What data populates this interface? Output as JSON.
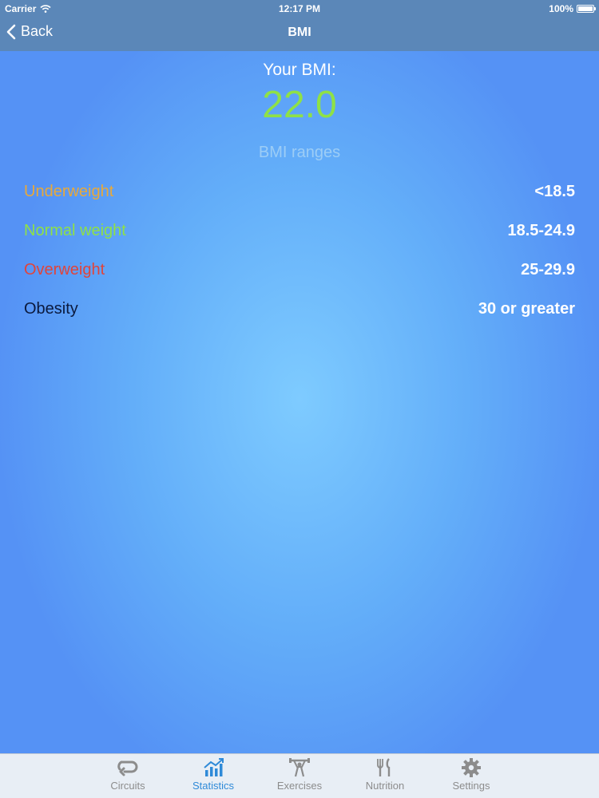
{
  "status_bar": {
    "carrier": "Carrier",
    "time": "12:17 PM",
    "battery": "100%",
    "battery_level": 1.0
  },
  "nav": {
    "back_label": "Back",
    "title": "BMI"
  },
  "bmi": {
    "label": "Your BMI:",
    "value": "22.0"
  },
  "ranges": {
    "heading": "BMI ranges",
    "items": [
      {
        "name": "Underweight",
        "value": "<18.5",
        "color": "#e8a93a"
      },
      {
        "name": "Normal weight",
        "value": "18.5-24.9",
        "color": "#8fe146"
      },
      {
        "name": "Overweight",
        "value": "25-29.9",
        "color": "#e1443a"
      },
      {
        "name": "Obesity",
        "value": "30 or greater",
        "color": "#0b1a3e"
      }
    ]
  },
  "tabs": [
    {
      "label": "Circuits",
      "icon": "circuits-icon",
      "active": false
    },
    {
      "label": "Statistics",
      "icon": "statistics-icon",
      "active": true
    },
    {
      "label": "Exercises",
      "icon": "exercises-icon",
      "active": false
    },
    {
      "label": "Nutrition",
      "icon": "nutrition-icon",
      "active": false
    },
    {
      "label": "Settings",
      "icon": "settings-icon",
      "active": false
    }
  ],
  "colors": {
    "accent_active_tab": "#2f8ad8",
    "bmi_value": "#8fe146",
    "nav_background": "#5b87b8"
  }
}
